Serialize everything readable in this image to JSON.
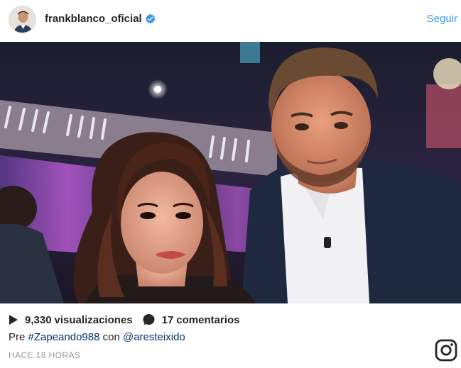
{
  "header": {
    "username": "frankblanco_oficial",
    "follow_label": "Seguir",
    "verified_icon": "verified-badge-icon",
    "colors": {
      "follow": "#3897f0",
      "verified": "#3897f0"
    }
  },
  "media": {
    "type": "photo",
    "description_icon": "post-photo"
  },
  "stats": {
    "views_count": "9,330",
    "views_label": "visualizaciones",
    "comments_count": "17",
    "comments_label": "comentarios"
  },
  "caption": {
    "prefix": "Pre",
    "hashtag": "#Zapeando988",
    "middle": "con",
    "mention": "@aresteixido"
  },
  "timestamp": "HACE 18 HORAS",
  "footer": {
    "logo_icon": "instagram-icon"
  }
}
